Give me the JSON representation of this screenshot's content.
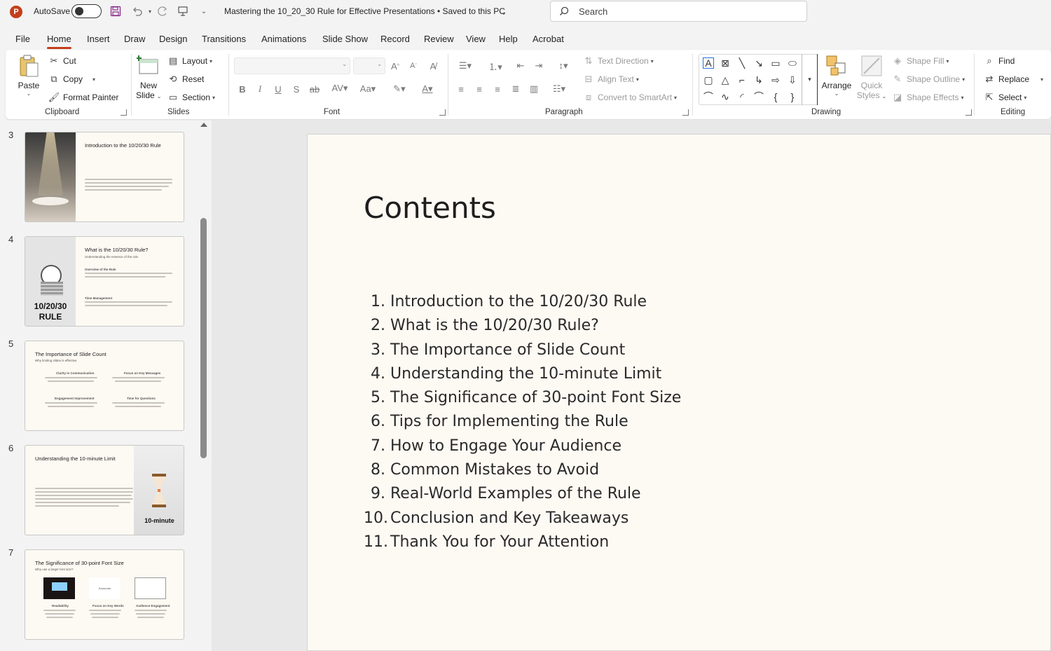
{
  "titlebar": {
    "app_icon": "powerpoint-logo",
    "app_letter": "P",
    "autosave_label": "AutoSave",
    "autosave_state": "Off",
    "document_title": "Mastering the 10_20_30 Rule for Effective Presentations  •  Saved to this PC",
    "search_placeholder": "Search"
  },
  "tabs": [
    "File",
    "Home",
    "Insert",
    "Draw",
    "Design",
    "Transitions",
    "Animations",
    "Slide Show",
    "Record",
    "Review",
    "View",
    "Help",
    "Acrobat"
  ],
  "active_tab": "Home",
  "ribbon": {
    "clipboard": {
      "label": "Clipboard",
      "paste": "Paste",
      "cut": "Cut",
      "copy": "Copy",
      "format_painter": "Format Painter"
    },
    "slides": {
      "label": "Slides",
      "new_slide_1": "New",
      "new_slide_2": "Slide",
      "layout": "Layout",
      "reset": "Reset",
      "section": "Section"
    },
    "font": {
      "label": "Font",
      "font_name": "",
      "font_size": ""
    },
    "paragraph": {
      "label": "Paragraph",
      "text_direction": "Text Direction",
      "align_text": "Align Text",
      "convert_smartart": "Convert to SmartArt"
    },
    "drawing": {
      "label": "Drawing",
      "arrange": "Arrange",
      "quick_styles_1": "Quick",
      "quick_styles_2": "Styles",
      "shape_fill": "Shape Fill",
      "shape_outline": "Shape Outline",
      "shape_effects": "Shape Effects"
    },
    "editing": {
      "label": "Editing",
      "find": "Find",
      "replace": "Replace",
      "select": "Select"
    }
  },
  "thumbnails": [
    {
      "number": "3",
      "title": "Introduction to the 10/20/30 Rule"
    },
    {
      "number": "4",
      "title": "What is the 10/20/30 Rule?",
      "subtitle": "Understanding the essence of the rule",
      "image_caption_1": "10/20/30",
      "image_caption_2": "RULE",
      "h1": "Overview of the Rule",
      "h2": "Time Management"
    },
    {
      "number": "5",
      "title": "The Importance of Slide Count",
      "subtitle": "Why limiting slides is effective",
      "c1": "Clarity in Communication",
      "c2": "Focus on Key Messages",
      "c3": "Engagement Improvement",
      "c4": "Time for Questions"
    },
    {
      "number": "6",
      "title": "Understanding the 10-minute Limit",
      "image_caption": "10-minute"
    },
    {
      "number": "7",
      "title": "The Significance of 30-point Font Size",
      "subtitle": "Why use a larger font size?",
      "c1": "Readability",
      "c2": "Focus on Key Words",
      "c3": "Audience Engagement",
      "mid_label": "Keywords"
    }
  ],
  "slide": {
    "title": "Contents",
    "items": [
      {
        "n": "1.",
        "text": "Introduction to the 10/20/30 Rule"
      },
      {
        "n": "2.",
        "text": "What is the 10/20/30 Rule?"
      },
      {
        "n": "3.",
        "text": "The Importance of Slide Count"
      },
      {
        "n": "4.",
        "text": "Understanding the 10-minute Limit"
      },
      {
        "n": "5.",
        "text": "The Significance of 30-point Font Size"
      },
      {
        "n": "6.",
        "text": "Tips for Implementing the Rule"
      },
      {
        "n": "7.",
        "text": "How to Engage Your Audience"
      },
      {
        "n": "8.",
        "text": "Common Mistakes to Avoid"
      },
      {
        "n": "9.",
        "text": "Real-World Examples of the Rule"
      },
      {
        "n": "10.",
        "text": "Conclusion and Key Takeaways"
      },
      {
        "n": "11.",
        "text": "Thank You for Your Attention"
      }
    ]
  },
  "colors": {
    "accent": "#c43e1c",
    "slide_bg": "#fdf9f3",
    "ribbon_bg": "#ffffff",
    "window_bg": "#f3f3f3"
  }
}
